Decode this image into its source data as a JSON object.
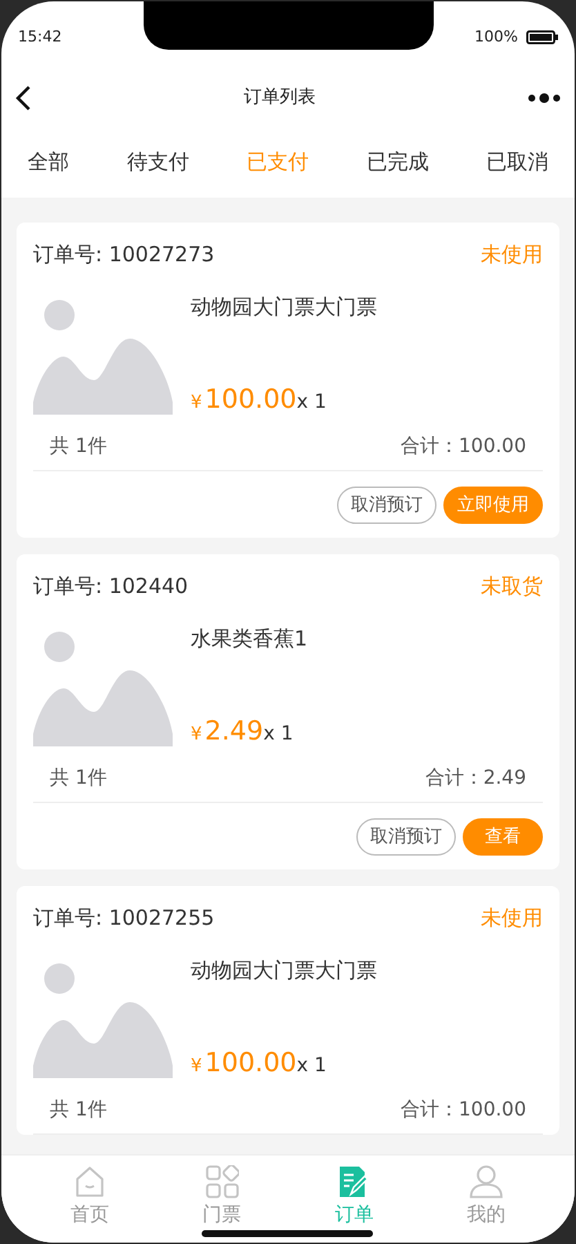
{
  "status_bar": {
    "time": "15:42",
    "battery": "100%"
  },
  "nav": {
    "title": "订单列表"
  },
  "tabs": [
    {
      "label": "全部",
      "selected": false
    },
    {
      "label": "待支付",
      "selected": false
    },
    {
      "label": "已支付",
      "selected": true
    },
    {
      "label": "已完成",
      "selected": false
    },
    {
      "label": "已取消",
      "selected": false
    }
  ],
  "orders": [
    {
      "number": "订单号: 10027273",
      "status": "未使用",
      "product": "动物园大门票大门票",
      "currency": "¥",
      "price": "100.00",
      "quantity": "x 1",
      "count": "共 1件",
      "total": "合计：100.00",
      "buttons": [
        {
          "label": "取消预订",
          "kind": "outline"
        },
        {
          "label": "立即使用",
          "kind": "filled"
        }
      ]
    },
    {
      "number": "订单号: 102440",
      "status": "未取货",
      "product": "水果类香蕉1",
      "currency": "¥",
      "price": "2.49",
      "quantity": "x 1",
      "count": "共 1件",
      "total": "合计：2.49",
      "buttons": [
        {
          "label": "取消预订",
          "kind": "outline"
        },
        {
          "label": "查看",
          "kind": "filled"
        }
      ]
    },
    {
      "number": "订单号: 10027255",
      "status": "未使用",
      "product": "动物园大门票大门票",
      "currency": "¥",
      "price": "100.00",
      "quantity": "x 1",
      "count": "共 1件",
      "total": "合计：100.00"
    }
  ],
  "tab_bar": [
    {
      "label": "首页",
      "kind": "home",
      "selected": false
    },
    {
      "label": "门票",
      "kind": "grid",
      "selected": false
    },
    {
      "label": "订单",
      "kind": "order",
      "selected": true
    },
    {
      "label": "我的",
      "kind": "user",
      "selected": false
    }
  ]
}
